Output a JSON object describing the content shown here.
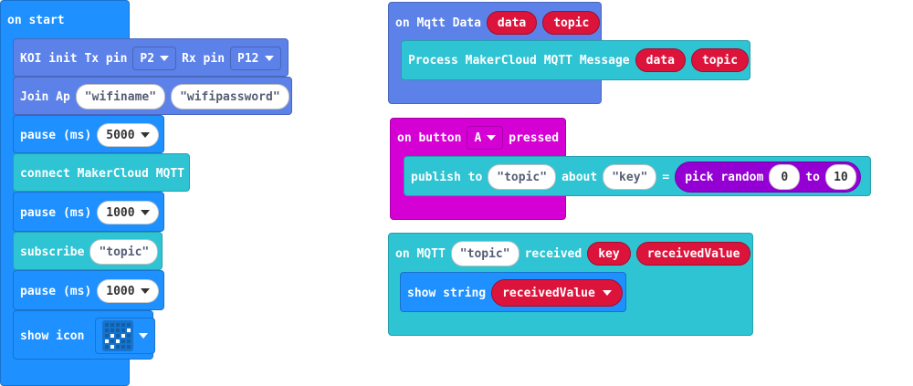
{
  "on_start": {
    "label": "on start",
    "koi_init": {
      "label": "KOI init Tx pin",
      "tx": "P2",
      "rx_label": "Rx pin",
      "rx": "P12"
    },
    "join_ap": {
      "label": "Join Ap",
      "ssid": "\"wifiname\"",
      "password": "\"wifipassword\""
    },
    "pause1": {
      "label": "pause (ms)",
      "value": "5000"
    },
    "connect": {
      "label": "connect MakerCloud MQTT"
    },
    "pause2": {
      "label": "pause (ms)",
      "value": "1000"
    },
    "subscribe": {
      "label": "subscribe",
      "topic": "\"topic\""
    },
    "pause3": {
      "label": "pause (ms)",
      "value": "1000"
    },
    "show_icon": {
      "label": "show icon"
    }
  },
  "on_mqtt_data": {
    "label": "on Mqtt Data",
    "param1": "data",
    "param2": "topic",
    "process": {
      "label": "Process MakerCloud MQTT Message",
      "arg1": "data",
      "arg2": "topic"
    }
  },
  "on_button": {
    "label": "on button",
    "button": "A",
    "pressed_label": "pressed",
    "publish": {
      "label": "publish to",
      "topic": "\"topic\"",
      "about_label": "about",
      "key": "\"key\"",
      "eq": "=",
      "random": {
        "label": "pick random",
        "from": "0",
        "to_label": "to",
        "to": "10"
      }
    }
  },
  "on_mqtt_received": {
    "label": "on MQTT",
    "topic": "\"topic\"",
    "received_label": "received",
    "param1": "key",
    "param2": "receivedValue",
    "show_string": {
      "label": "show string",
      "value": "receivedValue"
    }
  },
  "colors": {
    "basic": "#1e90ff",
    "koi": "#5c81e8",
    "mqtt": "#2ec4d3",
    "input": "#d400d4",
    "math": "#9400d3",
    "variable": "#dc143c"
  }
}
